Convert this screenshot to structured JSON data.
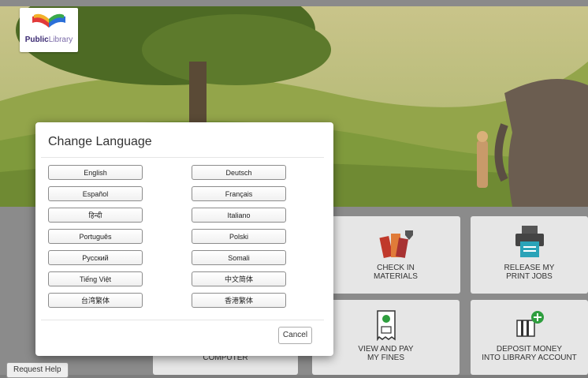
{
  "logo": {
    "brand_bold": "Public",
    "brand_rest": "Library"
  },
  "tiles": [
    {
      "label": "CHECK IN\nMATERIALS",
      "icon": "books-icon"
    },
    {
      "label": "RELEASE MY\nPRINT JOBS",
      "icon": "printer-icon"
    },
    {
      "label": "COMPUTER",
      "icon": "computer-icon"
    },
    {
      "label": "VIEW AND PAY\nMY FINES",
      "icon": "receipt-icon"
    },
    {
      "label": "DEPOSIT MONEY\nINTO LIBRARY ACCOUNT",
      "icon": "deposit-icon"
    }
  ],
  "request_help_label": "Request Help",
  "modal": {
    "title": "Change Language",
    "left_languages": [
      "English",
      "Español",
      "हिन्दी",
      "Português",
      "Русский",
      "Tiếng Việt",
      "台湾繁体"
    ],
    "right_languages": [
      "Deutsch",
      "Français",
      "Italiano",
      "Polski",
      "Somali",
      "中文简体",
      "香港繁体"
    ],
    "cancel_label": "Cancel"
  },
  "colors": {
    "accent_green": "#2e9e3e",
    "book_red": "#c0392b",
    "printer_teal": "#2aa3b8"
  }
}
